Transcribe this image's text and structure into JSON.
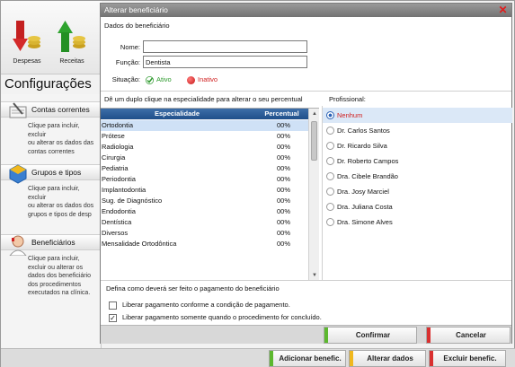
{
  "app": {
    "toolbar": [
      {
        "label": "Despesas",
        "icon": "despesas-arrow-down-icon"
      },
      {
        "label": "Receitas",
        "icon": "receitas-arrow-up-icon"
      }
    ],
    "heading": "Configurações",
    "sidebar": [
      {
        "title": "Contas correntes",
        "desc": "Clique para incluir, excluir\nou alterar os dados das\ncontas correntes",
        "icon": "notepad-icon"
      },
      {
        "title": "Grupos e tipos",
        "desc": "Clique para incluir, excluir\nou alterar os dados dos\ngrupos e tipos de desp",
        "icon": "hexagon-icon"
      },
      {
        "title": "Beneficiários",
        "desc": "Clique para incluir,\nexcluir ou alterar os\ndados dos beneficiário\ndos procedimentos\nexecutados na clínica.",
        "icon": "person-icon"
      }
    ],
    "bottom_buttons": [
      {
        "label": "Adicionar benefic.",
        "color": "#5cb82e"
      },
      {
        "label": "Alterar dados",
        "color": "#f0b81e"
      },
      {
        "label": "Excluir benefic.",
        "color": "#d93030"
      }
    ]
  },
  "modal": {
    "title": "Alterar beneficiário",
    "section": "Dados do beneficiário",
    "fields": {
      "nome_label": "Nome:",
      "nome_value": "",
      "funcao_label": "Função:",
      "funcao_value": "Dentista",
      "situacao_label": "Situação:",
      "ativo": "Ativo",
      "inativo": "Inativo",
      "selected": "Ativo"
    },
    "table_hint": "Dê um duplo clique na especialidade para alterar o seu percentual",
    "table": {
      "headers": [
        "Especialidade",
        "Percentual"
      ],
      "rows": [
        [
          "Ortodontia",
          "00%"
        ],
        [
          "Prótese",
          "00%"
        ],
        [
          "Radiologia",
          "00%"
        ],
        [
          "Cirurgia",
          "00%"
        ],
        [
          "Pediatria",
          "00%"
        ],
        [
          "Periodontia",
          "00%"
        ],
        [
          "Implantodontia",
          "00%"
        ],
        [
          "Sug. de Diagnóstico",
          "00%"
        ],
        [
          "Endodontia",
          "00%"
        ],
        [
          "Dentística",
          "00%"
        ],
        [
          "Diversos",
          "00%"
        ],
        [
          "Mensalidade Ortodôntica",
          "00%"
        ]
      ],
      "selected_index": 0
    },
    "profissional_label": "Profissional:",
    "profissionais": [
      "Nenhum",
      "Dr. Carlos Santos",
      "Dr. Ricardo Silva",
      "Dr. Roberto Campos",
      "Dra. Cibele Brandão",
      "Dra. Josy Marciel",
      "Dra. Juliana Costa",
      "Dra. Simone Alves"
    ],
    "profissional_selected": "Nenhum",
    "payment_label": "Defina como deverá ser feito o pagamento do beneficiário",
    "payment_options": [
      {
        "label": "Liberar pagamento conforme a condição de pagamento.",
        "checked": false
      },
      {
        "label": "Liberar pagamento somente quando o procedimento for concluído.",
        "checked": true
      }
    ],
    "buttons": {
      "confirm": "Confirmar",
      "cancel": "Cancelar"
    },
    "colors": {
      "confirm": "#5cb82e",
      "cancel": "#d93030",
      "header": "#2b5d9a",
      "ativo": "#2e9a2e",
      "inativo": "#d12222"
    }
  }
}
